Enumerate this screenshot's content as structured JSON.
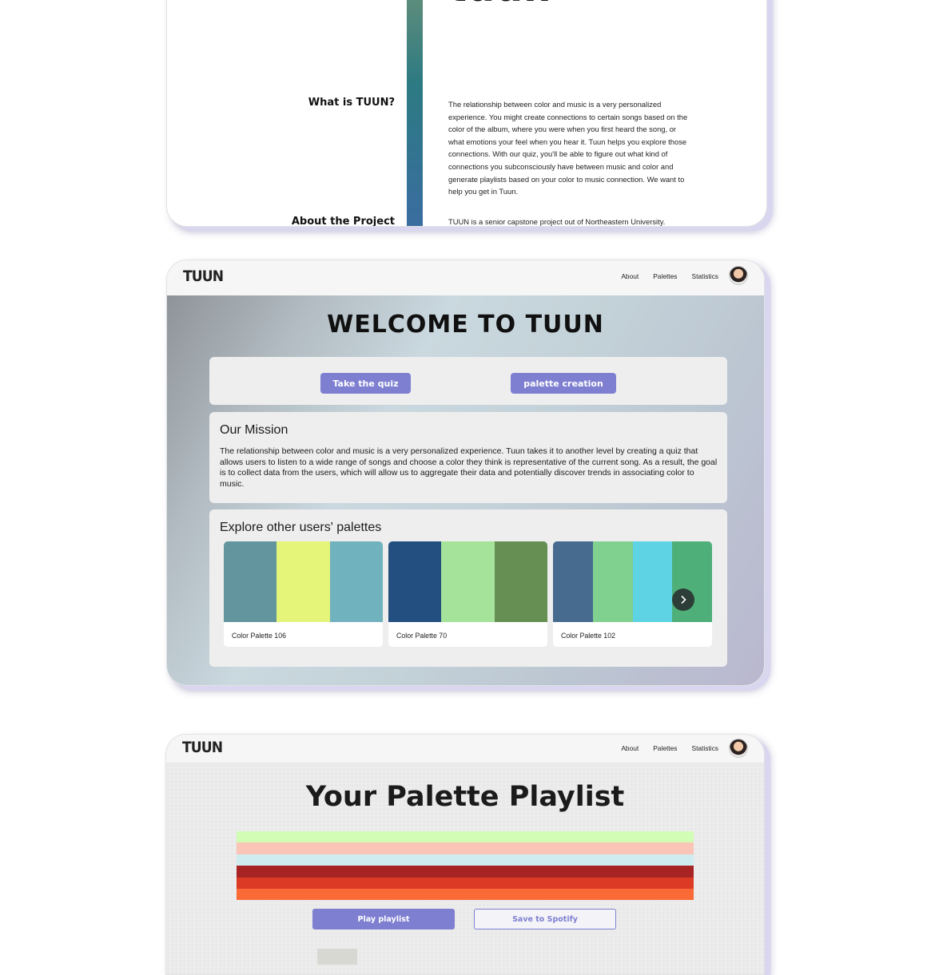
{
  "about_card": {
    "heading": "tuun",
    "what_title": "What is TUUN?",
    "what_text": "The relationship between color and music is a very personalized experience. You might create connections to certain songs based on the color of the album, where you were when you first heard the song, or what emotions your feel when you hear it. Tuun helps you explore those connections. With our quiz, you'll be able to figure out what kind of connections you subconsciously have between music and color and generate playlists based on your color to music connection. We want to help you get in Tuun.",
    "project_title": "About the Project",
    "project_text": "TUUN is a senior capstone project out of Northeastern University."
  },
  "nav": {
    "logo": "TUUN",
    "links": [
      "About",
      "Palettes",
      "Statistics"
    ]
  },
  "home": {
    "title": "WELCOME TO TUUN",
    "quiz_button": "Take the quiz",
    "palette_button": "palette creation",
    "mission_title": "Our Mission",
    "mission_text": "The relationship between color and music is a very personalized experience. Tuun takes it to another level by creating a quiz that allows users to listen to a wide range of songs and choose a color they think is representative of the current song. As a result, the goal is to collect data from the users, which will allow us to aggregate their data and potentially discover trends in associating color to music.",
    "explore_title": "Explore other users' palettes",
    "palettes": [
      {
        "label": "Color Palette 106",
        "colors": [
          "#63959e",
          "#e4f57a",
          "#70b2bd"
        ]
      },
      {
        "label": "Color Palette 70",
        "colors": [
          "#234f80",
          "#a4e399",
          "#668f53"
        ]
      },
      {
        "label": "Color Palette 102",
        "colors": [
          "#466b8f",
          "#80d08f",
          "#5dd3e4",
          "#4faf79"
        ]
      }
    ],
    "next_icon": "chevron-right-icon"
  },
  "playlist": {
    "title": "Your Palette Playlist",
    "bands": [
      "#d1fdb4",
      "#fac5b6",
      "#cfecf1",
      "#a82424",
      "#dc3a24",
      "#fa6a36"
    ],
    "play_button": "Play playlist",
    "save_button": "Save to Spotify"
  },
  "colors": {
    "accent": "#7e7fd1"
  }
}
